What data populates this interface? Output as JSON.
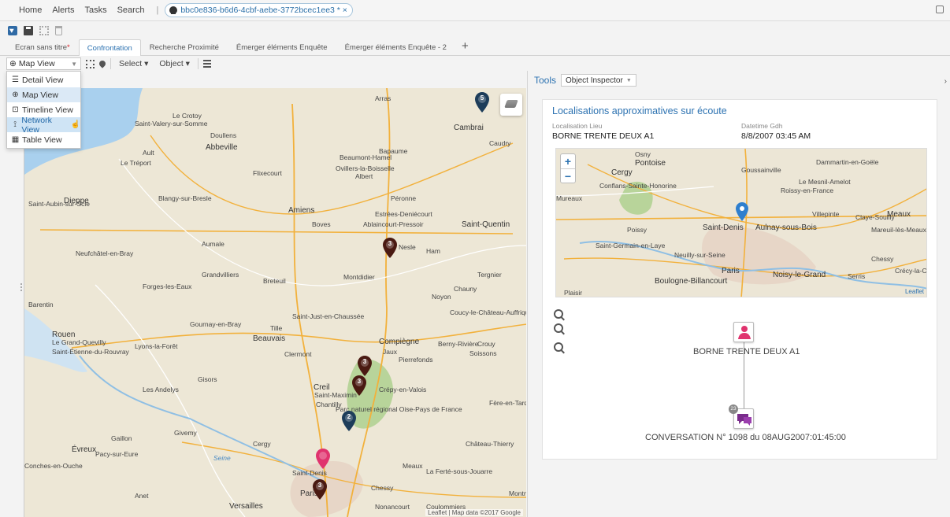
{
  "top_menu": {
    "home": "Home",
    "alerts": "Alerts",
    "tasks": "Tasks",
    "search": "Search"
  },
  "document_tab": {
    "title": "bbc0e836-b6d6-4cbf-aebe-3772bcec1ee3 * ×"
  },
  "tabs": [
    {
      "label": "Ecran sans titre",
      "dirty_mark": "*"
    },
    {
      "label": "Confrontation",
      "active": true
    },
    {
      "label": "Recherche Proximité"
    },
    {
      "label": "Émerger éléments Enquête"
    },
    {
      "label": "Émerger éléments Enquête - 2"
    }
  ],
  "tab_add": "+",
  "viewbar": {
    "current_view": "Map View",
    "select": "Select",
    "object": "Object"
  },
  "view_menu": {
    "items": [
      {
        "icon": "detail-view-icon",
        "glyph": "☰",
        "label": "Detail View"
      },
      {
        "icon": "map-view-icon",
        "glyph": "⊕",
        "label": "Map View"
      },
      {
        "icon": "timeline-view-icon",
        "glyph": "⊡",
        "label": "Timeline View"
      },
      {
        "icon": "network-view-icon",
        "glyph": "⟟",
        "label": "Network View"
      },
      {
        "icon": "table-view-icon",
        "glyph": "▦",
        "label": "Table View"
      }
    ]
  },
  "left_map": {
    "labels": [
      "Arras",
      "Le Crotoy",
      "Saint-Valery-sur-Somme",
      "Doullens",
      "Cambrai",
      "Caudry",
      "Abbeville",
      "Bapaume",
      "Ault",
      "Le Tréport",
      "Flixecourt",
      "Beaumont-Hamel",
      "Ovillers-la-Boisselle",
      "Albert",
      "Péronne",
      "Dieppe",
      "Blangy-sur-Bresle",
      "Amiens",
      "Estrées-Deniécourt",
      "Saint-Quentin",
      "Saint-Aubin-sur-Scie",
      "Boves",
      "Ablaincourt-Pressoir",
      "Aumale",
      "Nesle",
      "Ham",
      "Neufchâtel-en-Bray",
      "Grandvilliers",
      "Breteuil",
      "Montdidier",
      "Tergnier",
      "Chauny",
      "Noyon",
      "Forges-les-Eaux",
      "Barentin",
      "Saint-Just-en-Chaussée",
      "Coucy-le-Château-Auffrique",
      "Gournay-en-Bray",
      "Tille",
      "Rouen",
      "Beauvais",
      "Compiègne",
      "Berny-Rivière",
      "Crouy",
      "Le Grand-Quevilly",
      "Lyons-la-Forêt",
      "Clermont",
      "Jaux",
      "Pierrefonds",
      "Soissons",
      "Saint-Étienne-du-Rouvray",
      "Gisors",
      "Les Andelys",
      "Creil",
      "Saint-Maximin",
      "Chantilly",
      "Crépy-en-Valois",
      "Fère-en-Tardenois",
      "Parc naturel régional Oise-Pays de France",
      "Givemy",
      "Cergy",
      "Château-Thierry",
      "Évreux",
      "Pacy-sur-Eure",
      "Gaillon",
      "Conches-en-Ouche",
      "Saint-Denis",
      "Meaux",
      "La Ferté-sous-Jouarre",
      "Chessy",
      "Anet",
      "Paris",
      "Versailles",
      "Coulommiers",
      "Nonancourt",
      "Seine",
      "Montm"
    ],
    "credit": "Leaflet | Map data ©2017 Google"
  },
  "markers": [
    {
      "label": "5",
      "color": "#1d3d5a"
    },
    {
      "label": "3",
      "color": "#4a1a12"
    },
    {
      "label": "3",
      "color": "#4a1a12"
    },
    {
      "label": "3",
      "color": "#4a1a12"
    },
    {
      "label": "2",
      "color": "#1d3d5a"
    },
    {
      "label": "",
      "color": "#e0336e"
    },
    {
      "label": "3",
      "color": "#4a1a12"
    }
  ],
  "right_panel": {
    "tools_label": "Tools",
    "inspector": "Object Inspector",
    "card": {
      "title": "Localisations approximatives sur écoute",
      "field1_label": "Localisation Lieu",
      "field1_value": "BORNE TRENTE DEUX A1",
      "field2_label": "Datetime Gdh",
      "field2_value": "8/8/2007 03:45 AM"
    },
    "mini_map": {
      "labels": [
        "Osny",
        "Pontoise",
        "Cergy",
        "Goussainville",
        "Dammartin-en-Goële",
        "Le Mesnil-Amelot",
        "Conflans-Sainte-Honorine",
        "Roissy-en-France",
        "Mureaux",
        "Villepinte",
        "Meaux",
        "Claye-Souilly",
        "Poissy",
        "Saint-Denis",
        "Aulnay-sous-Bois",
        "Mareuil-lès-Meaux",
        "Saint-Germain-en-Laye",
        "Neuilly-sur-Seine",
        "Chessy",
        "Paris",
        "Crécy-la-Ch",
        "Boulogne-Billancourt",
        "Noisy-le-Grand",
        "Serris",
        "Plaisir"
      ],
      "zoom_in": "+",
      "zoom_out": "−",
      "attribution": "Leaflet"
    },
    "network": {
      "node1_label": "BORNE TRENTE DEUX A1",
      "node2_label": "CONVERSATION N° 1098 du 08AUG2007:01:45:00",
      "node2_badge": "23"
    }
  },
  "colors": {
    "accent": "#2c72b1",
    "dirty": "#d8232a",
    "marker_dark_blue": "#1d3d5a",
    "marker_brown": "#4a1a12",
    "marker_pink": "#e0336e",
    "person_node": "#e0336e",
    "conversation_node": "#7a2c8c"
  }
}
